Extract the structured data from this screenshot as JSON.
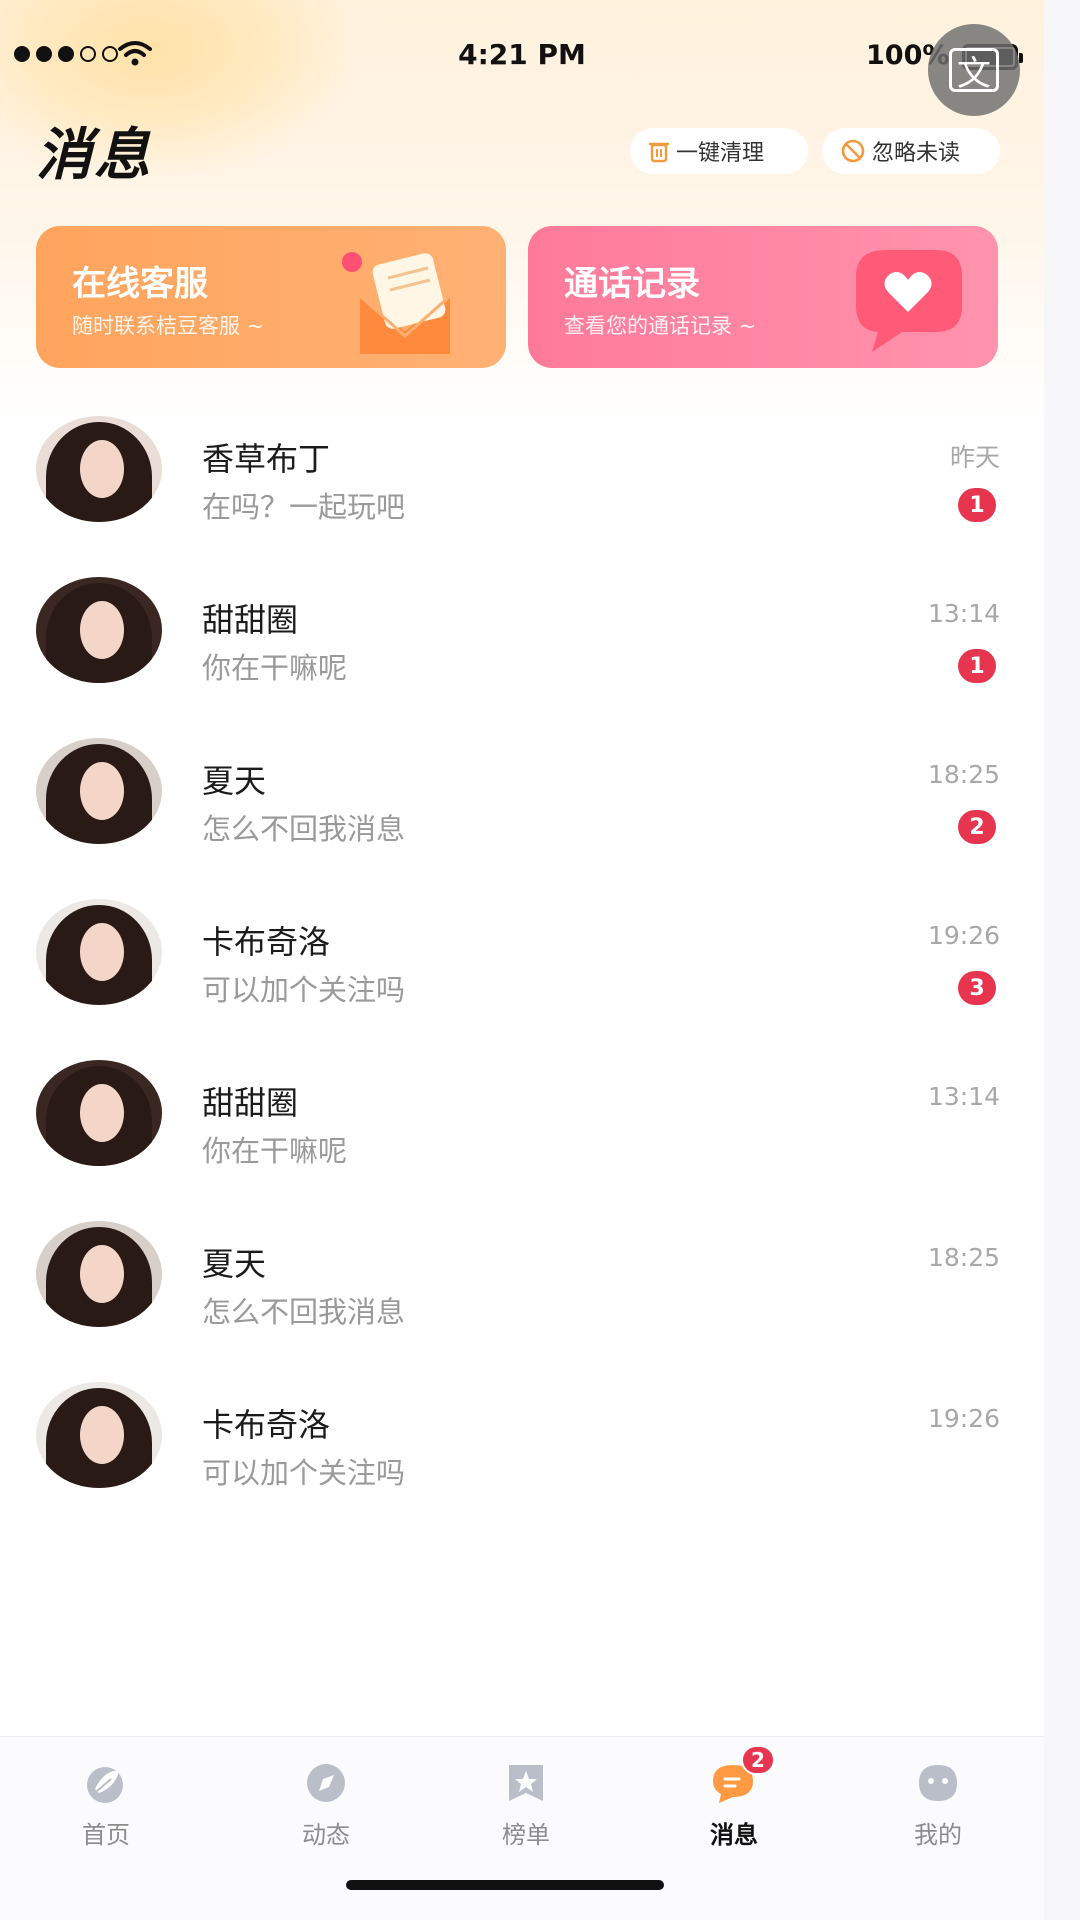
{
  "status_bar": {
    "time": "4:21 PM",
    "battery": "100%",
    "translate_label": "文"
  },
  "header": {
    "title": "消息",
    "clean_label": "一键清理",
    "ignore_label": "忽略未读"
  },
  "cards": {
    "service": {
      "title": "在线客服",
      "subtitle": "随时联系桔豆客服 ~"
    },
    "calls": {
      "title": "通话记录",
      "subtitle": "查看您的通话记录 ~"
    }
  },
  "messages": [
    {
      "name": "香草布丁",
      "preview": "在吗？一起玩吧",
      "time": "昨天",
      "unread": "1"
    },
    {
      "name": "甜甜圈",
      "preview": "你在干嘛呢",
      "time": "13:14",
      "unread": "1"
    },
    {
      "name": "夏天",
      "preview": "怎么不回我消息",
      "time": "18:25",
      "unread": "2"
    },
    {
      "name": "卡布奇洛",
      "preview": "可以加个关注吗",
      "time": "19:26",
      "unread": "3"
    },
    {
      "name": "甜甜圈",
      "preview": "你在干嘛呢",
      "time": "13:14",
      "unread": ""
    },
    {
      "name": "夏天",
      "preview": "怎么不回我消息",
      "time": "18:25",
      "unread": ""
    },
    {
      "name": "卡布奇洛",
      "preview": "可以加个关注吗",
      "time": "19:26",
      "unread": ""
    }
  ],
  "tabs": [
    {
      "label": "首页",
      "icon": "home-leaf-icon"
    },
    {
      "label": "动态",
      "icon": "compass-icon"
    },
    {
      "label": "榜单",
      "icon": "ranking-star-icon"
    },
    {
      "label": "消息",
      "icon": "message-bubble-icon",
      "badge": "2",
      "active": true
    },
    {
      "label": "我的",
      "icon": "profile-face-icon"
    }
  ],
  "colors": {
    "accent_orange": "#ffa45d",
    "accent_pink": "#ff7a9a",
    "badge_red": "#e8354f"
  }
}
